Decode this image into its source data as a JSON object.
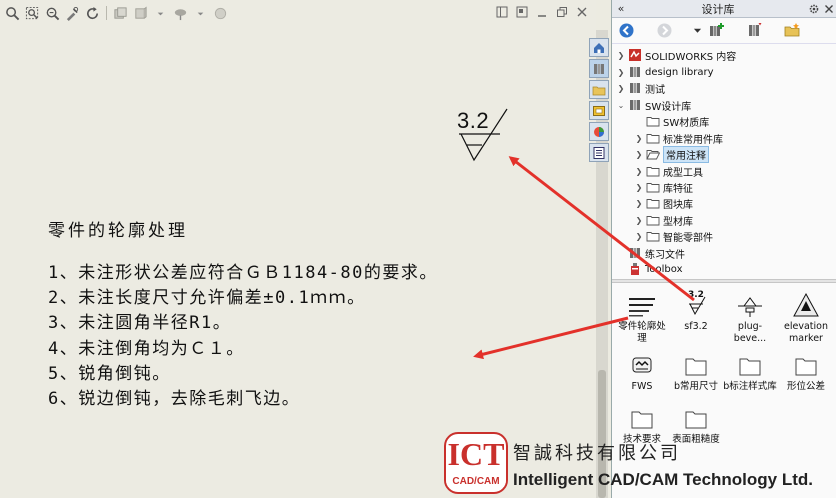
{
  "canvas": {
    "surface_symbol_value": "3.2",
    "notes": {
      "title": "零件的轮廓处理",
      "lines": [
        "1、未注形状公差应符合ＧＢ1184-80的要求。",
        "2、未注长度尺寸允许偏差±0.1ｍｍ。",
        "3、未注圆角半径R1。",
        "4、未注倒角均为Ｃ１。",
        "5、锐角倒钝。",
        "6、锐边倒钝，去除毛刺飞边。"
      ]
    }
  },
  "pane": {
    "collapse_glyph": "«",
    "title": "设计库",
    "tree": [
      {
        "label": "SOLIDWORKS 内容",
        "icon": "solidworks-content-icon",
        "expanded": false
      },
      {
        "label": "design library",
        "icon": "library-icon",
        "expanded": false
      },
      {
        "label": "测试",
        "icon": "library-icon",
        "expanded": false
      },
      {
        "label": "SW设计库",
        "icon": "library-icon",
        "expanded": true
      },
      {
        "label": "SW材质库",
        "icon": "folder-icon",
        "expanded": null
      },
      {
        "label": "标准常用件库",
        "icon": "folder-icon",
        "expanded": false
      },
      {
        "label": "常用注释",
        "icon": "folder-open-icon",
        "expanded": false,
        "selected": true
      },
      {
        "label": "成型工具",
        "icon": "folder-icon",
        "expanded": false
      },
      {
        "label": "库特征",
        "icon": "folder-icon",
        "expanded": false
      },
      {
        "label": "图块库",
        "icon": "folder-icon",
        "expanded": false
      },
      {
        "label": "型材库",
        "icon": "folder-icon",
        "expanded": false
      },
      {
        "label": "智能零部件",
        "icon": "folder-icon",
        "expanded": false
      },
      {
        "label": "练习文件",
        "icon": "library-icon",
        "expanded": null
      },
      {
        "label": "Toolbox",
        "icon": "toolbox-icon",
        "expanded": null
      }
    ],
    "items": [
      {
        "label": "零件轮廓处理",
        "thumb": "note-thumbnail"
      },
      {
        "label": "sf3.2",
        "thumb": "surface-finish-thumbnail",
        "thumb_text": "3.2"
      },
      {
        "label": "plug-beve...",
        "thumb": "plug-bevel-thumbnail"
      },
      {
        "label": "elevation marker",
        "thumb": "elevation-marker-thumbnail"
      },
      {
        "label": "FWS",
        "thumb": "fws-thumbnail"
      },
      {
        "label": "b常用尺寸",
        "thumb": "folder-icon"
      },
      {
        "label": "b标注样式库",
        "thumb": "folder-icon"
      },
      {
        "label": "形位公差",
        "thumb": "folder-icon"
      },
      {
        "label": "技术要求",
        "thumb": "folder-icon"
      },
      {
        "label": "表面粗糙度",
        "thumb": "folder-icon"
      }
    ]
  },
  "colors": {
    "canvas_bg": "#ecebe2",
    "arrow": "#e3312a",
    "selection": "#cde4f7",
    "brand_red": "#c9302c"
  },
  "watermark": {
    "logo_main": "ICT",
    "logo_sub": "CAD/CAM",
    "company_cn": "智誠科技有限公司",
    "company_en": "Intelligent CAD/CAM Technology Ltd."
  }
}
